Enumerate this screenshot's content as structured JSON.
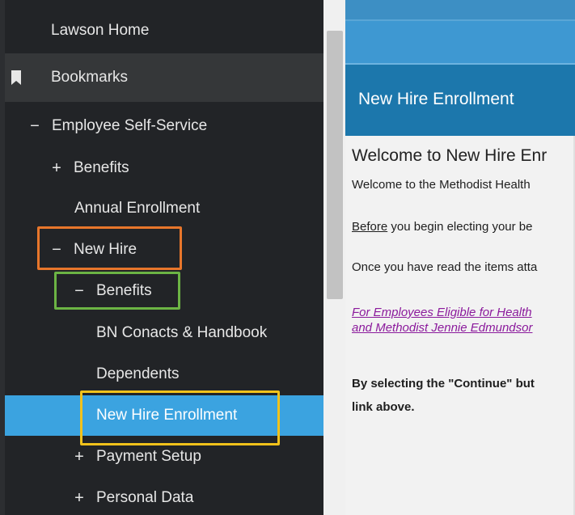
{
  "sidebar": {
    "lawson_home": "Lawson Home",
    "bookmarks": "Bookmarks",
    "employee_self_service": "Employee Self-Service",
    "benefits": "Benefits",
    "annual_enrollment": "Annual Enrollment",
    "new_hire": "New Hire",
    "new_hire_benefits": "Benefits",
    "bn_contacts": "BN Conacts & Handbook",
    "dependents": "Dependents",
    "new_hire_enrollment": "New Hire Enrollment",
    "payment_setup": "Payment Setup",
    "personal_data": "Personal Data",
    "sign_plus": "+",
    "sign_minus": "−"
  },
  "content": {
    "title": "New Hire Enrollment",
    "welcome_heading": "Welcome to New Hire Enr",
    "welcome_line": "Welcome to the Methodist Health",
    "before_word": "Before",
    "before_rest": " you begin electing your be",
    "once_line": "Once you have read the items atta",
    "link_line1": "For Employees Eligible for Health",
    "link_line2": "and Methodist Jennie Edmundsor",
    "bold_line1": "By selecting the \"Continue\" but",
    "bold_line2": "link above."
  },
  "colors": {
    "sidebar_bg": "#222427",
    "active_item": "#3ba3e0",
    "header_blue": "#1c77ac",
    "highlight_orange": "#e8762b",
    "highlight_green": "#6cb444",
    "highlight_yellow": "#f1c21b",
    "link_purple": "#8b1a9c"
  },
  "icons": {
    "bookmark": "bookmark-icon",
    "caret": "chevron-up-icon"
  }
}
